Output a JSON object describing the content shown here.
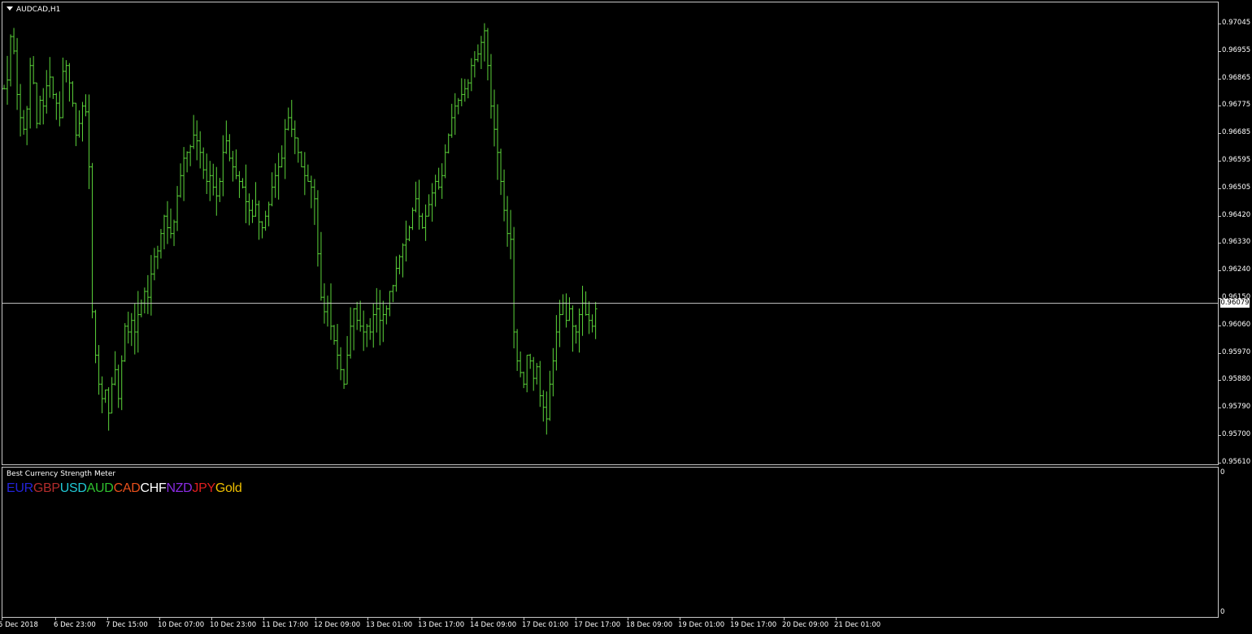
{
  "chart": {
    "symbol_title": "AUDCAD,H1",
    "bar_color": "#5bd33a",
    "price_line_color": "#c8c8c8",
    "current_price": "0.96079",
    "price_axis_labels": [
      "0.97045",
      "0.96955",
      "0.96865",
      "0.96775",
      "0.96685",
      "0.96595",
      "0.96505",
      "0.96420",
      "0.96330",
      "0.96240",
      "0.96150",
      "0.96060",
      "0.95970",
      "0.95880",
      "0.95790",
      "0.95700",
      "0.95610"
    ],
    "time_axis_labels": [
      "5 Dec 2018",
      "6 Dec 23:00",
      "7 Dec 15:00",
      "10 Dec 07:00",
      "10 Dec 23:00",
      "11 Dec 17:00",
      "12 Dec 09:00",
      "13 Dec 01:00",
      "13 Dec 17:00",
      "14 Dec 09:00",
      "17 Dec 01:00",
      "17 Dec 17:00",
      "18 Dec 09:00",
      "19 Dec 01:00",
      "19 Dec 17:00",
      "20 Dec 09:00",
      "21 Dec 01:00"
    ]
  },
  "chart_data": {
    "type": "ohlc",
    "title": "AUDCAD,H1",
    "ylim": [
      0.9561,
      0.97045
    ],
    "current_price": 0.96079,
    "values_close": [
      0.9682,
      0.9685,
      0.97,
      0.9695,
      0.968,
      0.9672,
      0.9668,
      0.9675,
      0.969,
      0.9684,
      0.967,
      0.9678,
      0.9676,
      0.9683,
      0.9686,
      0.968,
      0.9677,
      0.9672,
      0.9688,
      0.969,
      0.9684,
      0.9677,
      0.9666,
      0.967,
      0.9676,
      0.9674,
      0.9655,
      0.9605,
      0.959,
      0.958,
      0.9575,
      0.9578,
      0.957,
      0.958,
      0.9585,
      0.9575,
      0.9588,
      0.96,
      0.9598,
      0.9602,
      0.9598,
      0.9604,
      0.9608,
      0.9612,
      0.961,
      0.9618,
      0.9624,
      0.9626,
      0.9632,
      0.9638,
      0.9634,
      0.9632,
      0.9636,
      0.9645,
      0.9652,
      0.9658,
      0.966,
      0.9662,
      0.9666,
      0.9664,
      0.966,
      0.9654,
      0.965,
      0.9652,
      0.9648,
      0.9645,
      0.965,
      0.966,
      0.9664,
      0.9658,
      0.9655,
      0.9652,
      0.965,
      0.9648,
      0.9643,
      0.964,
      0.9638,
      0.9642,
      0.9636,
      0.9634,
      0.9638,
      0.9642,
      0.9648,
      0.9652,
      0.9655,
      0.9658,
      0.9668,
      0.9672,
      0.9668,
      0.9665,
      0.966,
      0.9655,
      0.9652,
      0.965,
      0.9648,
      0.9644,
      0.9625,
      0.961,
      0.9605,
      0.9608,
      0.96,
      0.9595,
      0.959,
      0.9585,
      0.958,
      0.959,
      0.96,
      0.9606,
      0.9602,
      0.96,
      0.9598,
      0.96,
      0.9598,
      0.9604,
      0.9606,
      0.9602,
      0.9604,
      0.9606,
      0.9612,
      0.9614,
      0.962,
      0.9624,
      0.9628,
      0.963,
      0.9634,
      0.964,
      0.9644,
      0.9638,
      0.9634,
      0.9638,
      0.9642,
      0.9646,
      0.965,
      0.9648,
      0.9652,
      0.966,
      0.9666,
      0.9672,
      0.9676,
      0.9678,
      0.968,
      0.9682,
      0.9684,
      0.969,
      0.9692,
      0.9694,
      0.9698,
      0.9702,
      0.969,
      0.9676,
      0.9668,
      0.966,
      0.965,
      0.964,
      0.9632,
      0.963,
      0.9598,
      0.9588,
      0.9584,
      0.958,
      0.959,
      0.9588,
      0.9582,
      0.9586,
      0.9576,
      0.9572,
      0.9568,
      0.958,
      0.9588,
      0.9598,
      0.9604,
      0.9608,
      0.9602,
      0.9606,
      0.96,
      0.9598,
      0.9604,
      0.9608,
      0.9604,
      0.9602,
      0.96,
      0.9606
    ]
  },
  "indicator": {
    "title": "Best Currency Strength Meter",
    "currencies": [
      {
        "label": "EUR",
        "color": "#2323d8"
      },
      {
        "label": "GBP",
        "color": "#b32c2c"
      },
      {
        "label": "USD",
        "color": "#21c9d6"
      },
      {
        "label": "AUD",
        "color": "#2fc02f"
      },
      {
        "label": "CAD",
        "color": "#e8501c"
      },
      {
        "label": "CHF",
        "color": "#ffffff"
      },
      {
        "label": "NZD",
        "color": "#8a2be2"
      },
      {
        "label": "JPY",
        "color": "#e01e1e"
      },
      {
        "label": "Gold",
        "color": "#f0c000"
      }
    ],
    "axis_top": "0",
    "axis_bottom": "0"
  }
}
